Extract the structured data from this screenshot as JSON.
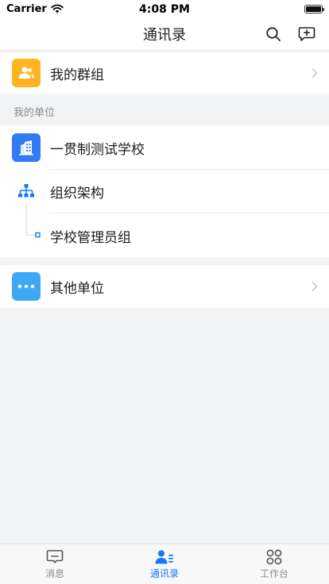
{
  "status": {
    "carrier": "Carrier",
    "time": "4:08 PM"
  },
  "nav": {
    "title": "通讯录"
  },
  "my_groups": {
    "label": "我的群组",
    "icon": "group-icon"
  },
  "section": {
    "header": "我的单位"
  },
  "org": {
    "school_name": "一贯制测试学校",
    "structure_label": "组织架构",
    "admin_group_label": "学校管理员组"
  },
  "other_units": {
    "label": "其他单位"
  },
  "tabs": [
    {
      "label": "消息",
      "icon": "message-icon"
    },
    {
      "label": "通讯录",
      "icon": "contacts-icon"
    },
    {
      "label": "工作台",
      "icon": "workbench-icon"
    }
  ],
  "colors": {
    "accent": "#1677ff",
    "group_icon_bg": "#ffb422",
    "school_icon_bg": "#2f7cf6",
    "other_icon_bg": "#3fa8f5"
  }
}
